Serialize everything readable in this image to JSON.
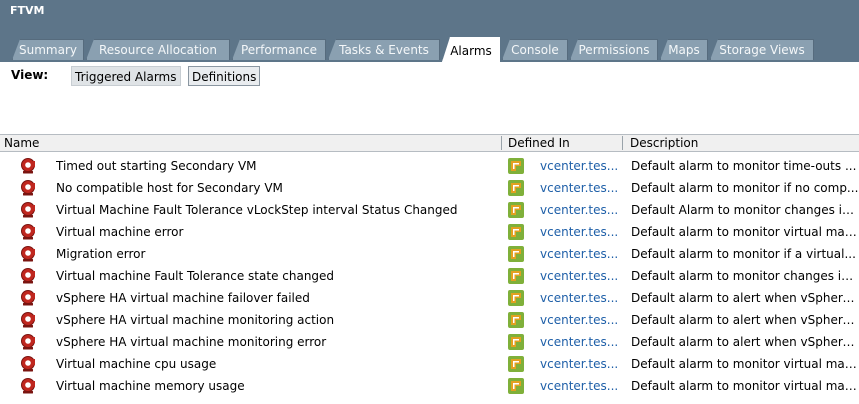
{
  "window": {
    "title": "FTVM"
  },
  "tabs": [
    {
      "label": "Summary"
    },
    {
      "label": "Resource Allocation"
    },
    {
      "label": "Performance"
    },
    {
      "label": "Tasks & Events"
    },
    {
      "label": "Alarms",
      "active": true
    },
    {
      "label": "Console"
    },
    {
      "label": "Permissions"
    },
    {
      "label": "Maps"
    },
    {
      "label": "Storage Views"
    }
  ],
  "view": {
    "label": "View:",
    "triggered": "Triggered Alarms",
    "definitions": "Definitions",
    "selected": "Definitions"
  },
  "table": {
    "columns": {
      "name": "Name",
      "defined_in": "Defined In",
      "description": "Description"
    },
    "rows": [
      {
        "name": "Timed out starting Secondary VM",
        "defined_in": "vcenter.tes...",
        "description": "Default alarm to monitor time-outs ..."
      },
      {
        "name": "No compatible host for Secondary VM",
        "defined_in": "vcenter.tes...",
        "description": "Default alarm to monitor if no comp..."
      },
      {
        "name": "Virtual Machine Fault Tolerance vLockStep interval Status Changed",
        "defined_in": "vcenter.tes...",
        "description": "Default Alarm to monitor changes in..."
      },
      {
        "name": "Virtual machine error",
        "defined_in": "vcenter.tes...",
        "description": "Default alarm to monitor virtual mac..."
      },
      {
        "name": "Migration error",
        "defined_in": "vcenter.tes...",
        "description": "Default alarm to monitor if a virtual..."
      },
      {
        "name": "Virtual machine Fault Tolerance state changed",
        "defined_in": "vcenter.tes...",
        "description": "Default alarm to monitor changes in ..."
      },
      {
        "name": "vSphere HA virtual machine failover failed",
        "defined_in": "vcenter.tes...",
        "description": "Default alarm to alert when vSphere..."
      },
      {
        "name": "vSphere HA virtual machine monitoring action",
        "defined_in": "vcenter.tes...",
        "description": "Default alarm to alert when vSphere..."
      },
      {
        "name": "vSphere HA virtual machine monitoring error",
        "defined_in": "vcenter.tes...",
        "description": "Default alarm to alert when vSphere..."
      },
      {
        "name": "Virtual machine cpu usage",
        "defined_in": "vcenter.tes...",
        "description": "Default alarm to monitor virtual mac..."
      },
      {
        "name": "Virtual machine memory usage",
        "defined_in": "vcenter.tes...",
        "description": "Default alarm to monitor virtual mac..."
      }
    ]
  },
  "icons": {
    "alarm": "alarm-definition-icon",
    "defined_in": "vcenter-icon"
  },
  "colors": {
    "header_bg": "#5d7589",
    "tab_bg": "#8aa0b1",
    "link": "#1e5fa8",
    "alarm_red": "#c0271f",
    "vcenter_green": "#7fb03a",
    "vcenter_orange": "#e3a020"
  }
}
